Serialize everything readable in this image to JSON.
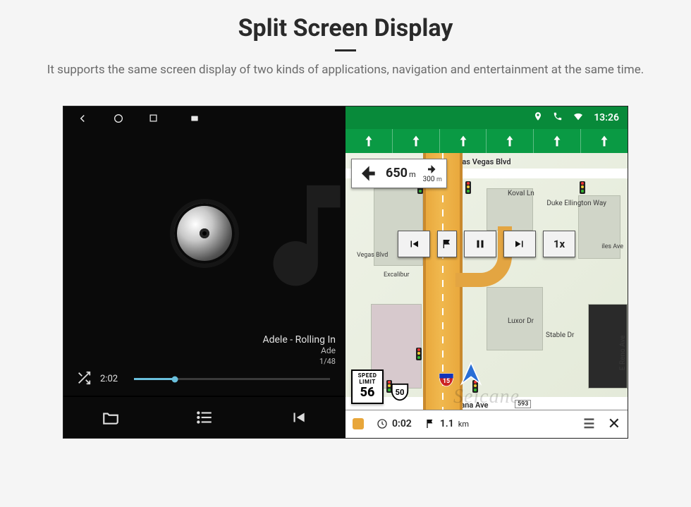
{
  "header": {
    "title": "Split Screen Display",
    "subtitle": "It supports the same screen display of two kinds of applications, navigation and entertainment at the same time."
  },
  "android_nav": {
    "back": "back-icon",
    "home": "home-icon",
    "recent": "recent-icon",
    "extra": "picture-icon"
  },
  "player": {
    "track_title": "Adele - Rolling In",
    "artist": "Ade",
    "position_index": "1/48",
    "elapsed": "2:02",
    "tabs": {
      "folder": "folder-icon",
      "list": "list-icon",
      "prev": "prev-icon"
    }
  },
  "status": {
    "gps": "location-icon",
    "phone": "phone-icon",
    "wifi": "wifi-icon",
    "time": "13:26"
  },
  "turn": {
    "distance_value": "650",
    "distance_unit": "m",
    "next_distance_value": "300",
    "next_distance_unit": "m"
  },
  "speed_limit": {
    "label": "SPEED LIMIT",
    "value": "56"
  },
  "route_shield": "50",
  "interstate_shield": "15",
  "controls": {
    "flag": "checkered-flag",
    "speed_label": "1x"
  },
  "streets": {
    "top": "S Las Vegas Blvd",
    "mid1": "Koval Ln",
    "mid2": "Duke Ellington Way",
    "right1": "E Reno Ave",
    "poi1": "Luxor Dr",
    "poi2": "Stable Dr",
    "poi_excalibur": "Excalibur",
    "poi_vegas": "Vegas Blvd",
    "poi_iles": "iles Ave",
    "bottom": "W Tropicana Ave",
    "bottom_num": "593"
  },
  "bottom_bar": {
    "eta_value": "0:02",
    "dist_value": "1.1",
    "dist_unit": "km"
  },
  "watermark": "Seicane"
}
